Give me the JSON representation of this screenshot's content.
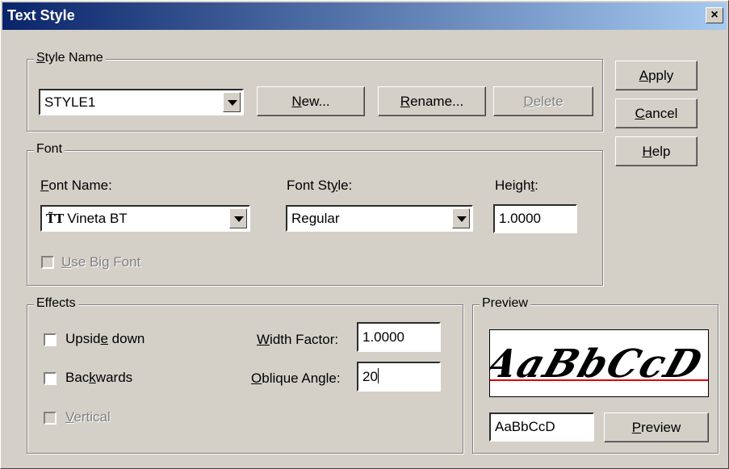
{
  "dialog": {
    "title": "Text Style",
    "close": "×"
  },
  "style_name_group": {
    "legend": "Style Name",
    "selected": "STYLE1",
    "new_label": "New...",
    "rename_label": "Rename...",
    "delete_label": "Delete"
  },
  "side_buttons": {
    "apply": "Apply",
    "cancel": "Cancel",
    "help": "Help"
  },
  "font_group": {
    "legend": "Font",
    "font_name_label": "Font Name:",
    "font_name_value": "Vineta BT",
    "font_name_icon": "truetype-icon",
    "font_style_label": "Font Style:",
    "font_style_value": "Regular",
    "height_label": "Height:",
    "height_value": "1.0000",
    "big_font_label": "Use Big Font",
    "big_font_checked": false
  },
  "effects_group": {
    "legend": "Effects",
    "upside_down": "Upside down",
    "backwards": "Backwards",
    "vertical": "Vertical",
    "width_factor_label": "Width Factor:",
    "width_factor_value": "1.0000",
    "oblique_label": "Oblique Angle:",
    "oblique_value": "20"
  },
  "preview_group": {
    "legend": "Preview",
    "sample_text": "AaBbCcD",
    "render_text": "AaBbCcD",
    "preview_button": "Preview",
    "baseline_color": "#e00000"
  }
}
